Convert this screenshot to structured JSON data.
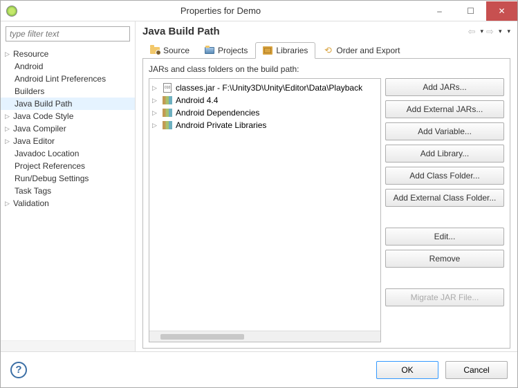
{
  "window": {
    "title": "Properties for Demo",
    "minimize": "–",
    "maximize": "☐",
    "close": "✕"
  },
  "sidebar": {
    "filter_placeholder": "type filter text",
    "items": [
      {
        "label": "Resource",
        "expandable": true
      },
      {
        "label": "Android",
        "expandable": false
      },
      {
        "label": "Android Lint Preferences",
        "expandable": false
      },
      {
        "label": "Builders",
        "expandable": false
      },
      {
        "label": "Java Build Path",
        "expandable": false,
        "selected": true
      },
      {
        "label": "Java Code Style",
        "expandable": true
      },
      {
        "label": "Java Compiler",
        "expandable": true
      },
      {
        "label": "Java Editor",
        "expandable": true
      },
      {
        "label": "Javadoc Location",
        "expandable": false
      },
      {
        "label": "Project References",
        "expandable": false
      },
      {
        "label": "Run/Debug Settings",
        "expandable": false
      },
      {
        "label": "Task Tags",
        "expandable": false
      },
      {
        "label": "Validation",
        "expandable": true
      }
    ]
  },
  "main": {
    "title": "Java Build Path",
    "tabs": [
      {
        "label": "Source",
        "icon": "source-folder-icon"
      },
      {
        "label": "Projects",
        "icon": "project-folder-icon"
      },
      {
        "label": "Libraries",
        "icon": "library-icon",
        "active": true
      },
      {
        "label": "Order and Export",
        "icon": "order-export-icon"
      }
    ],
    "libraries": {
      "description": "JARs and class folders on the build path:",
      "items": [
        {
          "label": "classes.jar - F:\\Unity3D\\Unity\\Editor\\Data\\Playback",
          "icon": "jar"
        },
        {
          "label": "Android 4.4",
          "icon": "books"
        },
        {
          "label": "Android Dependencies",
          "icon": "books"
        },
        {
          "label": "Android Private Libraries",
          "icon": "books"
        }
      ]
    },
    "buttons": [
      {
        "label": "Add JARs..."
      },
      {
        "label": "Add External JARs..."
      },
      {
        "label": "Add Variable..."
      },
      {
        "label": "Add Library..."
      },
      {
        "label": "Add Class Folder..."
      },
      {
        "label": "Add External Class Folder..."
      },
      {
        "gap": true
      },
      {
        "label": "Edit..."
      },
      {
        "label": "Remove"
      },
      {
        "gap": true
      },
      {
        "label": "Migrate JAR File...",
        "disabled": true
      }
    ]
  },
  "footer": {
    "ok": "OK",
    "cancel": "Cancel"
  }
}
